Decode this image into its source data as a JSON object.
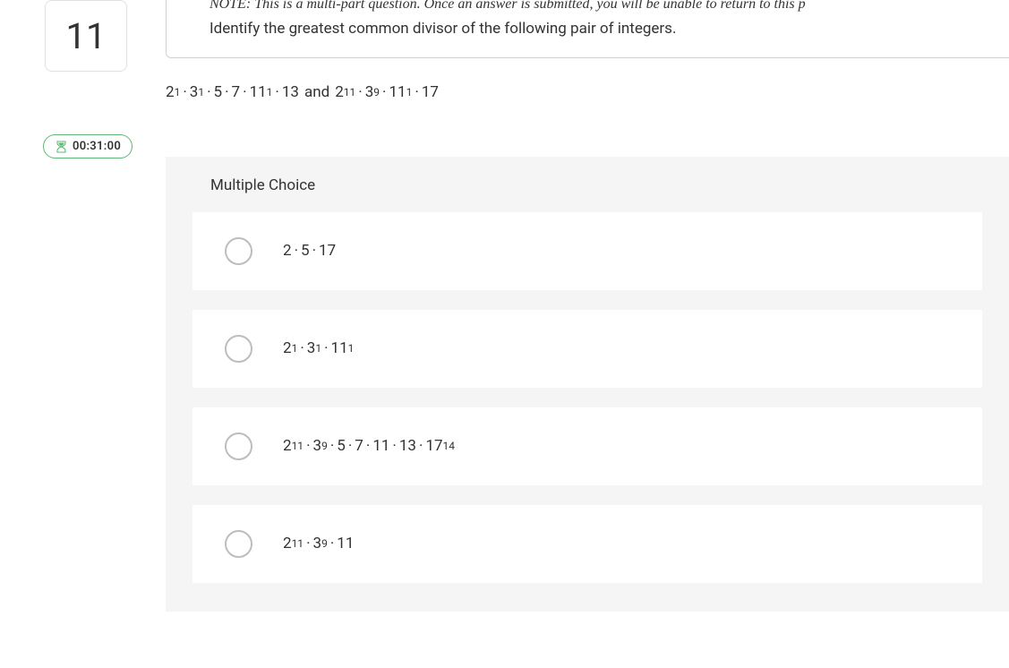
{
  "question_number": "11",
  "timer": "00:31:00",
  "note_prefix": "NOTE:",
  "note_text": "This is a multi-part question. Once an answer is submitted, you will be unable to return to this p",
  "instruction": "Identify the greatest common divisor of the following pair of integers.",
  "expr": {
    "a": [
      {
        "base": "2",
        "sup": "1"
      },
      {
        "base": "3",
        "sup": "1"
      },
      {
        "base": "5",
        "sup": ""
      },
      {
        "base": "7",
        "sup": ""
      },
      {
        "base": "11",
        "sup": "1"
      },
      {
        "base": "13",
        "sup": ""
      }
    ],
    "and": "and",
    "b": [
      {
        "base": "2",
        "sup": "11"
      },
      {
        "base": "3",
        "sup": "9"
      },
      {
        "base": "11",
        "sup": "1"
      },
      {
        "base": "17",
        "sup": ""
      }
    ]
  },
  "panel_title": "Multiple Choice",
  "options": [
    [
      {
        "base": "2",
        "sup": ""
      },
      {
        "base": "5",
        "sup": ""
      },
      {
        "base": "17",
        "sup": ""
      }
    ],
    [
      {
        "base": "2",
        "sup": "1"
      },
      {
        "base": "3",
        "sup": "1"
      },
      {
        "base": "11",
        "sup": "1"
      }
    ],
    [
      {
        "base": "2",
        "sup": "11"
      },
      {
        "base": "3",
        "sup": "9"
      },
      {
        "base": "5",
        "sup": ""
      },
      {
        "base": "7",
        "sup": ""
      },
      {
        "base": "11",
        "sup": ""
      },
      {
        "base": "13",
        "sup": ""
      },
      {
        "base": "17",
        "sup": "14"
      }
    ],
    [
      {
        "base": "2",
        "sup": "11"
      },
      {
        "base": "3",
        "sup": "9"
      },
      {
        "base": "11",
        "sup": ""
      }
    ]
  ]
}
